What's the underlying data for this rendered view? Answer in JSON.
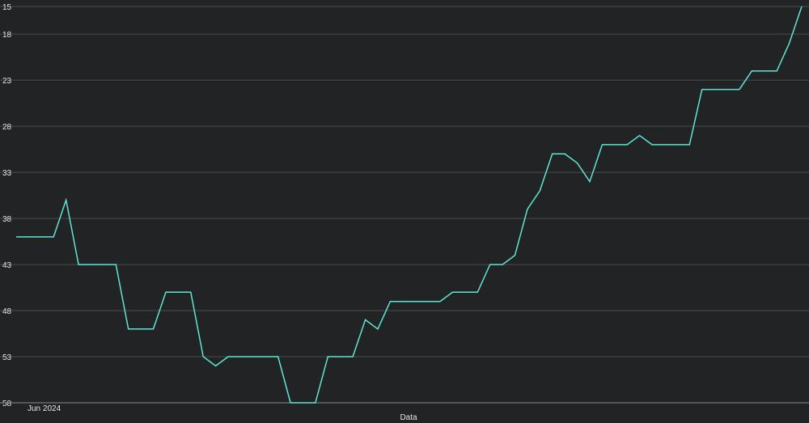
{
  "chart_data": {
    "type": "line",
    "title": "",
    "xlabel": "Data",
    "ylabel": "",
    "y_axis_inverted": true,
    "ylim": [
      58,
      15
    ],
    "y_ticks": [
      15,
      18,
      23,
      28,
      33,
      38,
      43,
      48,
      53,
      58
    ],
    "x_tick_labels": [
      "Jun 2024"
    ],
    "grid": "horizontal",
    "colors": {
      "line": "#5ee5d3",
      "grid": "#4a4b4e",
      "axis": "#8a8a8a",
      "background": "#222325"
    },
    "series": [
      {
        "values": [
          40,
          40,
          40,
          40,
          36,
          43,
          43,
          43,
          43,
          50,
          50,
          50,
          46,
          46,
          46,
          53,
          54,
          53,
          53,
          53,
          53,
          53,
          58,
          58,
          58,
          53,
          53,
          53,
          49,
          50,
          47,
          47,
          47,
          47,
          47,
          46,
          46,
          46,
          43,
          43,
          42,
          37,
          35,
          31,
          31,
          32,
          34,
          30,
          30,
          30,
          29,
          30,
          30,
          30,
          30,
          24,
          24,
          24,
          24,
          22,
          22,
          22,
          19,
          15
        ]
      }
    ]
  }
}
